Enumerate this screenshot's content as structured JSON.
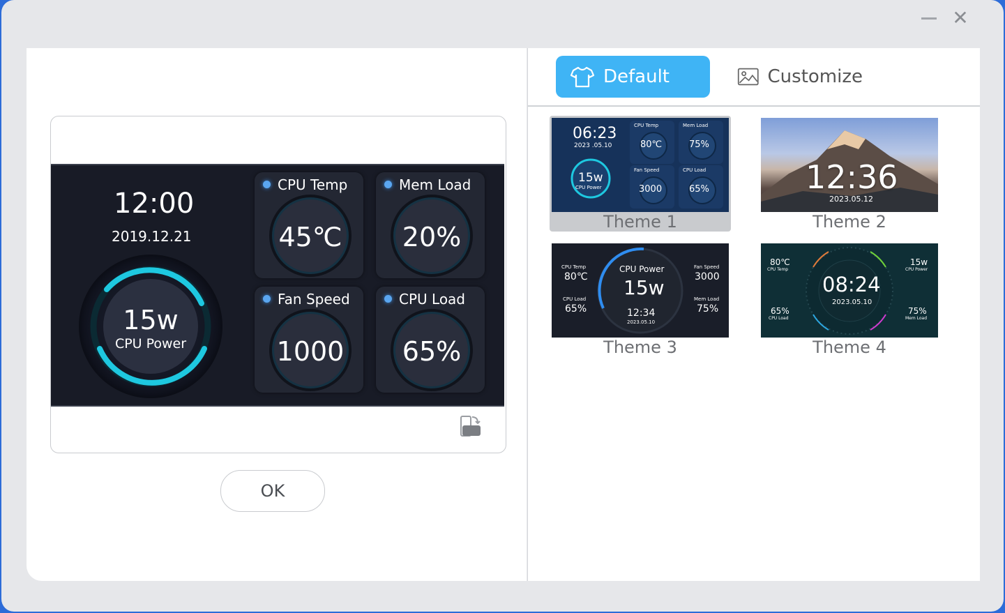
{
  "window": {
    "minimize_icon": "minimize-icon",
    "close_icon": "close-icon",
    "close_glyph": "✕"
  },
  "preview": {
    "time": "12:00",
    "date": "2019.12.21",
    "cpu_power": {
      "value": "15w",
      "label": "CPU Power"
    },
    "tiles": [
      {
        "label": "CPU Temp",
        "value": "45℃"
      },
      {
        "label": "Mem Load",
        "value": "20%"
      },
      {
        "label": "Fan Speed",
        "value": "1000"
      },
      {
        "label": "CPU Load",
        "value": "65%"
      }
    ],
    "rotate_icon": "rotate-screen-icon"
  },
  "ok_label": "OK",
  "tabs": {
    "default_label": "Default",
    "customize_label": "Customize"
  },
  "themes": [
    {
      "label": "Theme 1",
      "time": "06:23",
      "date": "2023 .05.10",
      "power": "15w",
      "power_label": "CPU Power",
      "stats": [
        {
          "label": "CPU Temp",
          "value": "80℃"
        },
        {
          "label": "Mem Load",
          "value": "75%"
        },
        {
          "label": "Fan Speed",
          "value": "3000"
        },
        {
          "label": "CPU Load",
          "value": "65%"
        }
      ]
    },
    {
      "label": "Theme 2",
      "time": "12:36",
      "date": "2023.05.12"
    },
    {
      "label": "Theme 3",
      "center_label": "CPU Power",
      "center_value": "15w",
      "time": "12:34",
      "date": "2023.05.10",
      "left_top_label": "CPU Temp",
      "left_top_value": "80℃",
      "left_bottom_label": "CPU Load",
      "left_bottom_value": "65%",
      "right_top_label": "Fan Speed",
      "right_top_value": "3000",
      "right_bottom_label": "Mem Load",
      "right_bottom_value": "75%"
    },
    {
      "label": "Theme 4",
      "time": "08:24",
      "date": "2023.05.10",
      "tl_value": "80℃",
      "tl_label": "CPU Temp",
      "tr_value": "15w",
      "tr_label": "CPU Power",
      "bl_value": "65%",
      "bl_label": "CPU Load",
      "br_value": "75%",
      "br_label": "Mem Load"
    }
  ],
  "colors": {
    "accent": "#3fb4f5",
    "ring": "#1ec8e0",
    "screen_bg": "#181b26"
  }
}
